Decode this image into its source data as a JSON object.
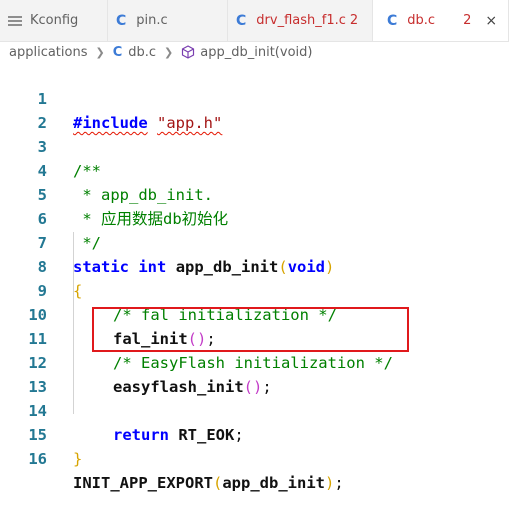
{
  "tabs": [
    {
      "label": "Kconfig",
      "icon": "lines-icon",
      "active": false
    },
    {
      "label": "pin.c",
      "icon": "c-file-icon",
      "active": false
    },
    {
      "label": "drv_flash_f1.c",
      "icon": "c-file-icon",
      "active": false,
      "errors": "2"
    },
    {
      "label": "db.c",
      "icon": "c-file-icon",
      "active": true,
      "errors": "2",
      "close": "×"
    }
  ],
  "file_icon_letter": "C",
  "breadcrumb": {
    "folder": "applications",
    "file": "db.c",
    "symbol": "app_db_init(void)"
  },
  "editor": {
    "line_numbers": [
      "1",
      "2",
      "3",
      "4",
      "5",
      "6",
      "7",
      "8",
      "9",
      "10",
      "11",
      "12",
      "13",
      "14",
      "15",
      "16"
    ],
    "tokens": {
      "include": "#include",
      "include_path": "\"app.h\"",
      "doc_open": "/**",
      "doc_line1": " * app_db_init.",
      "doc_line2": " * 应用数据db初始化",
      "doc_close": " */",
      "static": "static",
      "int": "int",
      "fn_name": "app_db_init",
      "void": "void",
      "brace_open": "{",
      "comment_fal": "/* fal initialization */",
      "call_fal": "fal_init",
      "comment_ef": "/* EasyFlash initialization */",
      "call_ef": "easyflash_init",
      "return": "return",
      "rt_eok": "RT_EOK",
      "brace_close": "}",
      "export_macro": "INIT_APP_EXPORT",
      "export_arg": "app_db_init"
    }
  },
  "colors": {
    "keyword": "#0000ff",
    "string": "#a31515",
    "comment": "#008000",
    "line_number": "#237893",
    "highlight_box": "#e0191c"
  }
}
